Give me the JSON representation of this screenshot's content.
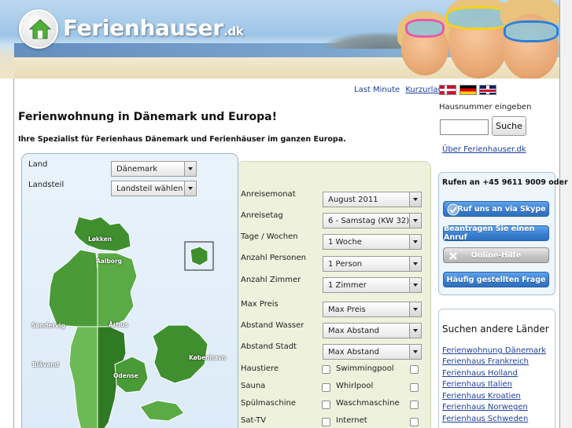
{
  "header": {
    "logo_text": "Ferienhauser",
    "logo_tld": ".dk"
  },
  "top_links": {
    "last_minute": "Last Minute",
    "kurzurlaub": "Kurzurlaub",
    "flags": [
      "flag-dk",
      "flag-de",
      "flag-uk"
    ]
  },
  "main": {
    "title": "Ferienwohnung in Dänemark und Europa!",
    "subtitle": "Ihre Spezialist für Ferienhaus Dänemark und Ferienhäuser im ganzen Europa."
  },
  "map_panel": {
    "land_label": "Land",
    "land_value": "Dänemark",
    "landsteil_label": "Landsteil",
    "landsteil_value": "Landsteil wählen",
    "cities": [
      "Løkken",
      "Aalborg",
      "Søndervig",
      "Århus",
      "Blåvand",
      "Odense",
      "København"
    ]
  },
  "search_form": {
    "fields": [
      {
        "label": "Anreisemonat",
        "value": "August 2011"
      },
      {
        "label": "Anreisetag",
        "value": "6 - Samstag (KW 32)"
      },
      {
        "label": "Tage / Wochen",
        "value": "1 Woche"
      },
      {
        "label": "Anzahl Personen",
        "value": "1 Person"
      },
      {
        "label": "Anzahl Zimmer",
        "value": "1 Zimmer"
      },
      {
        "label": "Max Preis",
        "value": "Max Preis"
      },
      {
        "label": "Abstand Wasser",
        "value": "Max Abstand"
      },
      {
        "label": "Abstand Stadt",
        "value": "Max Abstand"
      }
    ],
    "checkboxes_left": [
      "Haustiere",
      "Sauna",
      "Spülmaschine",
      "Sat-TV"
    ],
    "checkboxes_right": [
      "Swimmingpool",
      "Whirlpool",
      "Waschmaschine",
      "Internet"
    ]
  },
  "sidebar": {
    "house_number_label": "Hausnummer eingeben",
    "house_number_value": "",
    "search_button": "Suche",
    "about_link": "Über Ferienhauser.dk",
    "contact_title": "Rufen an +45 9611 9009 oder",
    "contact_buttons": [
      "Ruf uns an via Skype",
      "Beantragen Sie einen Anruf",
      "Online-Hilfe",
      "Häufig gestellten Frage"
    ],
    "other_countries_title": "Suchen andere Länder",
    "other_countries": [
      "Ferienwohnung Dänemark",
      "Ferienhaus Frankreich",
      "Ferienhaus Holland",
      "Ferienhaus Italien",
      "Ferienhaus Kroatien",
      "Ferienhaus Norwegen",
      "Ferienhaus Schweden"
    ]
  }
}
